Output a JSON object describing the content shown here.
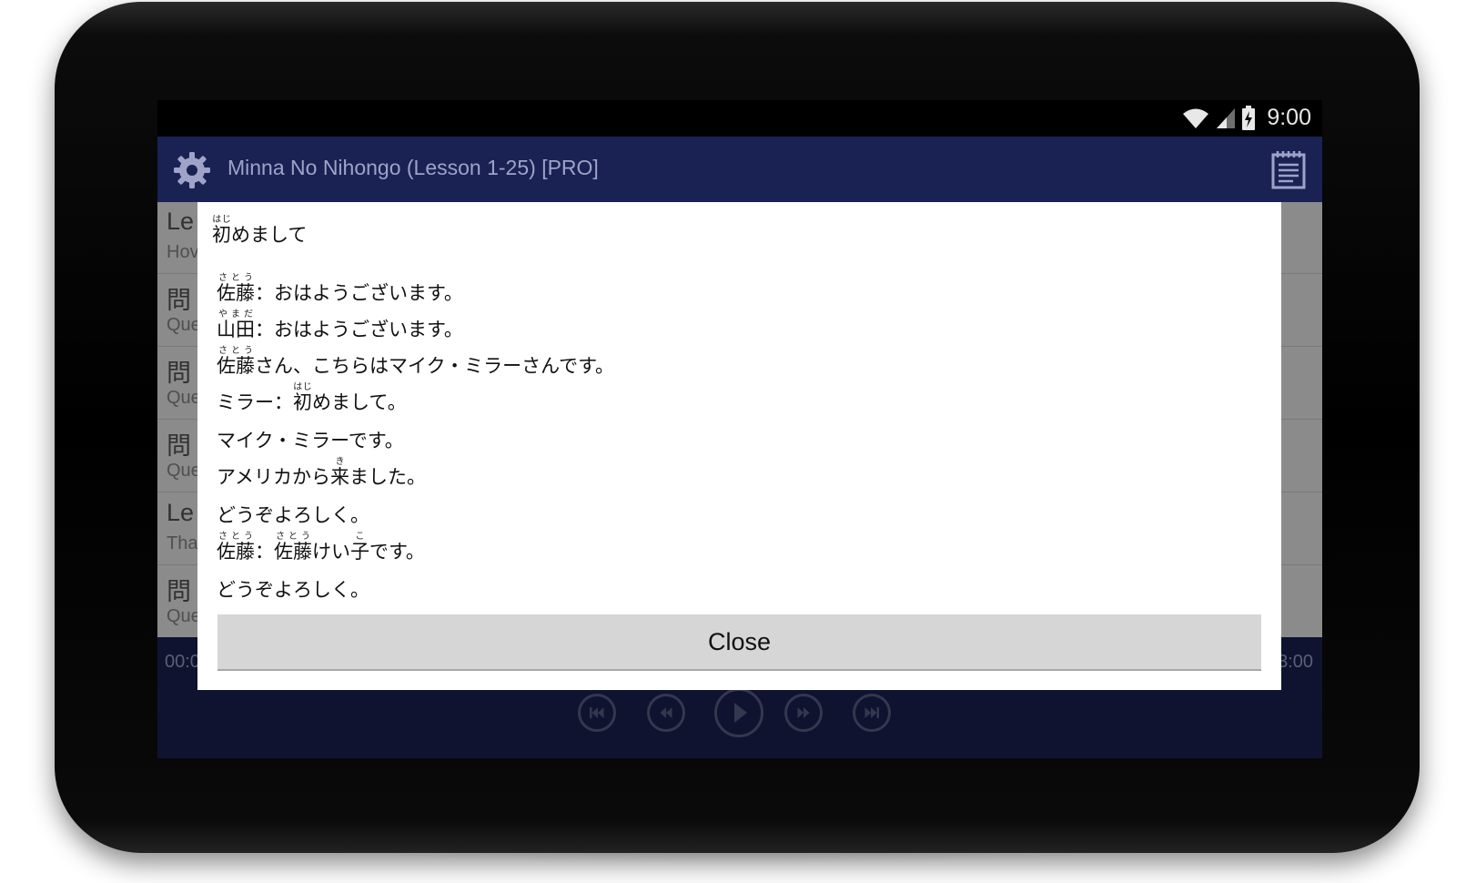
{
  "status_bar": {
    "time": "9:00"
  },
  "app_bar": {
    "title": "Minna No Nihongo (Lesson 1-25) [PRO]"
  },
  "list": {
    "items": [
      {
        "title": "Le",
        "subtitle": "Hov"
      },
      {
        "title": "問",
        "subtitle": "Que"
      },
      {
        "title": "問",
        "subtitle": "Que"
      },
      {
        "title": "問",
        "subtitle": "Que"
      },
      {
        "title": "Le",
        "subtitle": "Tha"
      },
      {
        "title": "問",
        "subtitle": "Que"
      }
    ]
  },
  "player": {
    "time_current": "00:0",
    "time_total": "3:00"
  },
  "dialog": {
    "heading": {
      "kanji": "初",
      "reading": "はじ",
      "rest": "めまして"
    },
    "lines": {
      "l1": {
        "k1": "佐藤",
        "r1": "さとう",
        "text": "：おはようございます。"
      },
      "l2": {
        "k1": "山田",
        "r1": "やまだ",
        "text": "：おはようございます。"
      },
      "l3": {
        "k1": "佐藤",
        "r1": "さとう",
        "text": "さん、こちらはマイク・ミラーさんです。"
      },
      "l4": {
        "pre": "ミラー：",
        "k1": "初",
        "r1": "はじ",
        "text": "めまして。"
      },
      "l5": {
        "text": "マイク・ミラーです。"
      },
      "l6": {
        "pre": "アメリカから",
        "k1": "来",
        "r1": "き",
        "text": "ました。"
      },
      "l7": {
        "text": "どうぞよろしく。"
      },
      "l8": {
        "k1": "佐藤",
        "r1": "さとう",
        "mid1": "：",
        "k2": "佐藤",
        "r2": "さとう",
        "mid2": "けい",
        "k3": "子",
        "r3": "こ",
        "text": "です。"
      },
      "l9": {
        "text": "どうぞよろしく。"
      }
    },
    "close_label": "Close"
  }
}
